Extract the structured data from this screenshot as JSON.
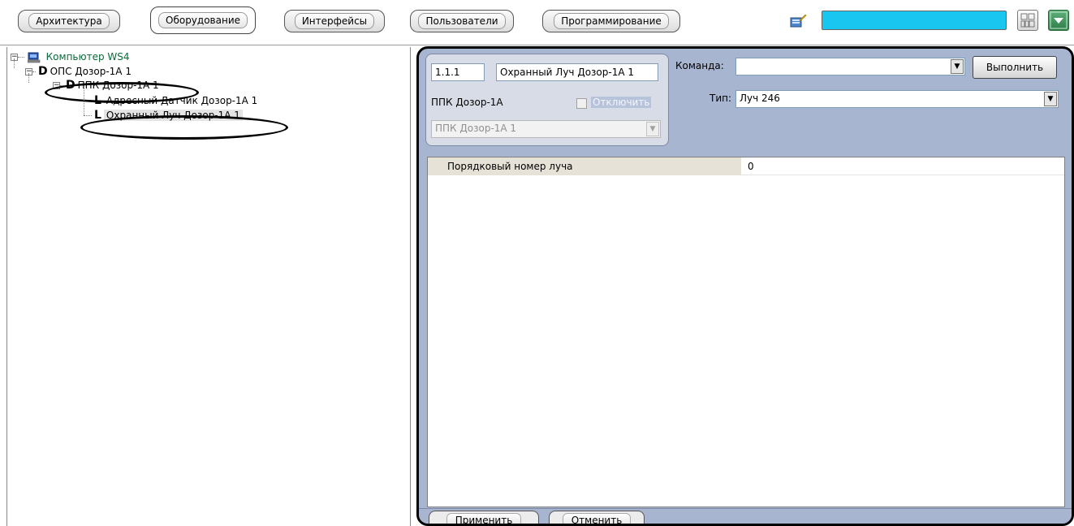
{
  "tabs": [
    {
      "label": "Архитектура",
      "active": false
    },
    {
      "label": "Оборудование",
      "active": true
    },
    {
      "label": "Интерфейсы",
      "active": false
    },
    {
      "label": "Пользователи",
      "active": false
    },
    {
      "label": "Программирование",
      "active": false
    }
  ],
  "toolbar": {
    "search_color": "#18c6f0",
    "icons": [
      "edit-icon",
      "layout-icon",
      "dropdown-arrow-icon"
    ]
  },
  "tree": {
    "root": {
      "label": "Компьютер WS4",
      "icon": "computer-icon",
      "expander": "⊟"
    },
    "ops": {
      "label": "ОПС Дозор-1А 1",
      "letter": "D",
      "expander": "⊟"
    },
    "ppk": {
      "label": "ППК Дозор-1А 1",
      "letter": "D",
      "expander": "⊟"
    },
    "sensor": {
      "label": "Адресный Датчик Дозор-1А 1",
      "letter": "L"
    },
    "beam": {
      "label": "Охранный Луч Дозор-1А 1",
      "letter": "L"
    }
  },
  "settings": {
    "id_value": "1.1.1",
    "name_value": "Охранный Луч Дозор-1А 1",
    "parent_label": "ППК Дозор-1А",
    "disable_label": "Отключить",
    "parent_select": "ППК Дозор-1А 1",
    "command_label": "Команда:",
    "command_value": "",
    "execute_label": "Выполнить",
    "type_label": "Тип:",
    "type_value": "Луч 246"
  },
  "properties": [
    {
      "name": "Порядковый номер луча",
      "value": "0"
    }
  ],
  "footer": {
    "apply_label": "Применить",
    "cancel_label": "Отменить"
  },
  "colors": {
    "panel_bg": "#a8b5d1",
    "search_box": "#18c6f0",
    "accent_green": "#2e7d4a"
  }
}
